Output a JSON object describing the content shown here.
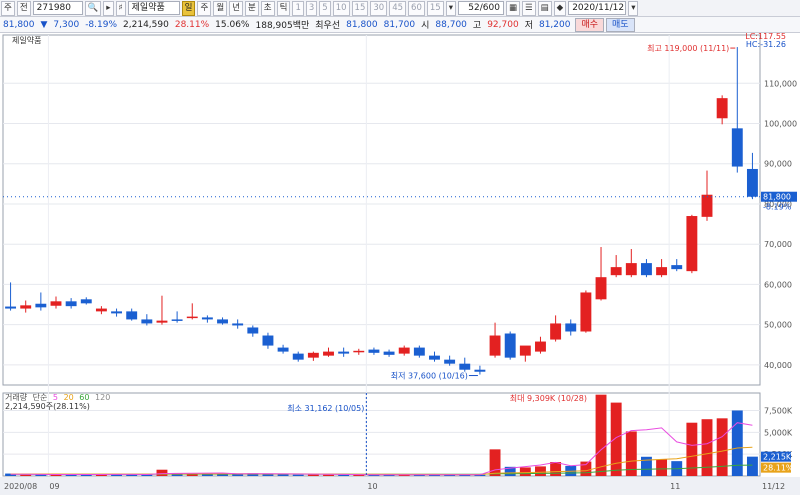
{
  "toolbar": {
    "period_select": "주",
    "scope_select": "전",
    "stock_code": "271980",
    "stock_name": "제일약품",
    "periods": [
      "일",
      "주",
      "월",
      "년",
      "분",
      "초",
      "틱"
    ],
    "selected_period": "일",
    "intervals": [
      "1",
      "3",
      "5",
      "10",
      "15",
      "30",
      "45",
      "60",
      "15"
    ],
    "page_indicator": "52/600",
    "date": "2020/11/12"
  },
  "quote": {
    "price": "81,800",
    "change": "7,300",
    "change_pct": "-8.19%",
    "volume": "2,214,590",
    "volume_ratio": "28.11%",
    "rate2": "15.06%",
    "trade_value": "188,905백만",
    "best_bid_label": "최우선",
    "ask": "81,800",
    "bid": "81,700",
    "open_label": "시",
    "open": "88,700",
    "high_label": "고",
    "high": "92,700",
    "low_label": "저",
    "low": "81,200",
    "buy_label": "매수",
    "sell_label": "매도"
  },
  "chart_data": {
    "type": "candlestick",
    "title": "제일약품",
    "price_axis": {
      "ylim": [
        35000,
        122000
      ],
      "ticks": [
        40000,
        50000,
        60000,
        70000,
        80000,
        90000,
        100000,
        110000
      ],
      "tick_labels": [
        "40,000",
        "50,000",
        "60,000",
        "70,000",
        "80,000",
        "90,000",
        "100,000",
        "110,000"
      ]
    },
    "volume_axis": {
      "ylim": [
        0,
        9500000
      ],
      "ticks": [
        2500000,
        5000000,
        7500000
      ],
      "tick_labels": [
        "2,500K",
        "5,000K",
        "7,500K"
      ]
    },
    "time_axis_labels": [
      {
        "text": "2020/08",
        "index": 0
      },
      {
        "text": "09",
        "index": 3
      },
      {
        "text": "10",
        "index": 24
      },
      {
        "text": "11",
        "index": 44
      },
      {
        "text": "11/12",
        "index": 53
      }
    ],
    "candles": [
      {
        "o": 54500,
        "h": 60500,
        "c": 54000,
        "l": 53500
      },
      {
        "o": 54000,
        "h": 56000,
        "c": 54800,
        "l": 53000
      },
      {
        "o": 55200,
        "h": 58000,
        "c": 54300,
        "l": 53500
      },
      {
        "o": 54700,
        "h": 57000,
        "c": 55800,
        "l": 54000
      },
      {
        "o": 55800,
        "h": 56600,
        "c": 54600,
        "l": 54000
      },
      {
        "o": 56300,
        "h": 56800,
        "c": 55300,
        "l": 55000
      },
      {
        "o": 53300,
        "h": 54600,
        "c": 54000,
        "l": 52600
      },
      {
        "o": 53300,
        "h": 54000,
        "c": 52800,
        "l": 52000
      },
      {
        "o": 53300,
        "h": 54000,
        "c": 51300,
        "l": 51000
      },
      {
        "o": 51300,
        "h": 52600,
        "c": 50300,
        "l": 49800
      },
      {
        "o": 50500,
        "h": 57200,
        "c": 51000,
        "l": 50000
      },
      {
        "o": 51300,
        "h": 53300,
        "c": 51000,
        "l": 50500
      },
      {
        "o": 51800,
        "h": 55300,
        "c": 52000,
        "l": 51300
      },
      {
        "o": 51800,
        "h": 52300,
        "c": 51300,
        "l": 50500
      },
      {
        "o": 51300,
        "h": 51800,
        "c": 50300,
        "l": 50000
      },
      {
        "o": 50300,
        "h": 51300,
        "c": 49800,
        "l": 49000
      },
      {
        "o": 49300,
        "h": 49800,
        "c": 47800,
        "l": 47000
      },
      {
        "o": 47300,
        "h": 48000,
        "c": 44800,
        "l": 44000
      },
      {
        "o": 44300,
        "h": 45000,
        "c": 43300,
        "l": 42800
      },
      {
        "o": 42800,
        "h": 43300,
        "c": 41300,
        "l": 40800
      },
      {
        "o": 41800,
        "h": 43300,
        "c": 43000,
        "l": 41000
      },
      {
        "o": 42300,
        "h": 44300,
        "c": 43300,
        "l": 42000
      },
      {
        "o": 43300,
        "h": 44300,
        "c": 42800,
        "l": 42000
      },
      {
        "o": 43300,
        "h": 44000,
        "c": 43500,
        "l": 42500
      },
      {
        "o": 43800,
        "h": 44300,
        "c": 43000,
        "l": 42500
      },
      {
        "o": 43300,
        "h": 43800,
        "c": 42500,
        "l": 42000
      },
      {
        "o": 42800,
        "h": 44800,
        "c": 44300,
        "l": 42300
      },
      {
        "o": 44300,
        "h": 44800,
        "c": 42300,
        "l": 41800
      },
      {
        "o": 42300,
        "h": 43300,
        "c": 41300,
        "l": 40800
      },
      {
        "o": 41300,
        "h": 42300,
        "c": 40300,
        "l": 39800
      },
      {
        "o": 40300,
        "h": 41800,
        "c": 38800,
        "l": 38300
      },
      {
        "o": 38800,
        "h": 39800,
        "c": 38300,
        "l": 37600
      },
      {
        "o": 42300,
        "h": 50500,
        "c": 47300,
        "l": 41800
      },
      {
        "o": 47800,
        "h": 48300,
        "c": 41800,
        "l": 41300
      },
      {
        "o": 42300,
        "h": 44300,
        "c": 44800,
        "l": 40800
      },
      {
        "o": 43300,
        "h": 47000,
        "c": 45800,
        "l": 42800
      },
      {
        "o": 46300,
        "h": 52300,
        "c": 50300,
        "l": 45800
      },
      {
        "o": 50300,
        "h": 51300,
        "c": 48300,
        "l": 47300
      },
      {
        "o": 48300,
        "h": 58500,
        "c": 58000,
        "l": 48000
      },
      {
        "o": 56300,
        "h": 69300,
        "c": 61800,
        "l": 56000
      },
      {
        "o": 62300,
        "h": 67300,
        "c": 64300,
        "l": 61800
      },
      {
        "o": 62300,
        "h": 68800,
        "c": 65300,
        "l": 61800
      },
      {
        "o": 65300,
        "h": 66300,
        "c": 62300,
        "l": 61800
      },
      {
        "o": 62300,
        "h": 66300,
        "c": 64300,
        "l": 61800
      },
      {
        "o": 64800,
        "h": 66300,
        "c": 63800,
        "l": 63300
      },
      {
        "o": 63300,
        "h": 77300,
        "c": 77000,
        "l": 62800
      },
      {
        "o": 76800,
        "h": 88300,
        "c": 82300,
        "l": 75800
      },
      {
        "o": 101300,
        "h": 107000,
        "c": 106300,
        "l": 99800
      },
      {
        "o": 98800,
        "h": 119000,
        "c": 89300,
        "l": 87800
      },
      {
        "o": 88700,
        "h": 92700,
        "c": 81800,
        "l": 81200
      }
    ],
    "volume": [
      280000,
      150000,
      180000,
      160000,
      170000,
      150000,
      180000,
      210000,
      170000,
      150000,
      720000,
      250000,
      300000,
      230000,
      190000,
      220000,
      310000,
      290000,
      210000,
      150000,
      160000,
      150000,
      140000,
      160000,
      120000,
      130000,
      150000,
      140000,
      160000,
      180000,
      120000,
      140000,
      3050000,
      1050000,
      980000,
      1100000,
      1600000,
      1150000,
      1650000,
      9309000,
      8400000,
      5100000,
      2200000,
      1900000,
      1700000,
      6100000,
      6500000,
      6600000,
      7500000,
      2214590
    ],
    "volume_ma5": [
      200000,
      190000,
      180000,
      175000,
      170000,
      170000,
      175000,
      185000,
      180000,
      175000,
      280000,
      300000,
      320000,
      330000,
      340000,
      240000,
      250000,
      260000,
      240000,
      230000,
      220000,
      200000,
      180000,
      160000,
      150000,
      145000,
      140000,
      140000,
      145000,
      150000,
      150000,
      150000,
      700000,
      900000,
      1080000,
      1260000,
      1560000,
      1180000,
      1300000,
      3000000,
      4400000,
      5200000,
      5300000,
      5500000,
      3900000,
      3500000,
      3700000,
      4500000,
      6100000,
      5800000
    ],
    "volume_ma20": [
      230000,
      228000,
      226000,
      224000,
      222000,
      220000,
      222000,
      224000,
      222000,
      220000,
      240000,
      245000,
      250000,
      252000,
      254000,
      250000,
      248000,
      246000,
      240000,
      235000,
      230000,
      215000,
      205000,
      198000,
      195000,
      190000,
      186000,
      182000,
      178000,
      175000,
      170000,
      168000,
      310000,
      350000,
      390000,
      430000,
      500000,
      540000,
      600000,
      1050000,
      1450000,
      1700000,
      1820000,
      1900000,
      1980000,
      2250000,
      2550000,
      2850000,
      3200000,
      3300000
    ],
    "volume_ma60": [
      210000,
      210000,
      210000,
      210000,
      210000,
      210000,
      210000,
      210000,
      210000,
      210000,
      215000,
      215000,
      215000,
      215000,
      215000,
      215000,
      215000,
      215000,
      215000,
      215000,
      214000,
      213000,
      212000,
      211000,
      210000,
      209000,
      208000,
      207000,
      206000,
      205000,
      204000,
      203000,
      250000,
      265000,
      280000,
      300000,
      320000,
      340000,
      365000,
      520000,
      660000,
      740000,
      780000,
      810000,
      830000,
      920000,
      1010000,
      1100000,
      1220000,
      1250000
    ],
    "annotations": {
      "high": {
        "text": "최고 119,000 (11/11)",
        "index": 48
      },
      "low": {
        "text": "최저 37,600 (10/16)",
        "index": 31
      },
      "vol_max": {
        "text": "최대 9,309K (10/28)",
        "index": 39
      },
      "vol_min": {
        "text": "최소 31,162 (10/05)"
      }
    },
    "last_price": {
      "label": "81,800",
      "pct": "-8.19%"
    },
    "lc_label": "LC:117.55",
    "hc_label": "HC:-31.26",
    "volume_legend": {
      "name": "거래량",
      "ma_label": "단순",
      "ma": [
        "5",
        "20",
        "60",
        "120"
      ],
      "value_text": "2,214,590주(28.11%)"
    },
    "volume_last_label": "2,215K",
    "volume_ratio_label": "28.11%",
    "colors": {
      "up": "#e32121",
      "down": "#1a5fd1",
      "ma5": "#e94ce0",
      "ma20": "#e8a31a",
      "ma60": "#3aa63a",
      "ma120": "#8a8a8a"
    }
  }
}
